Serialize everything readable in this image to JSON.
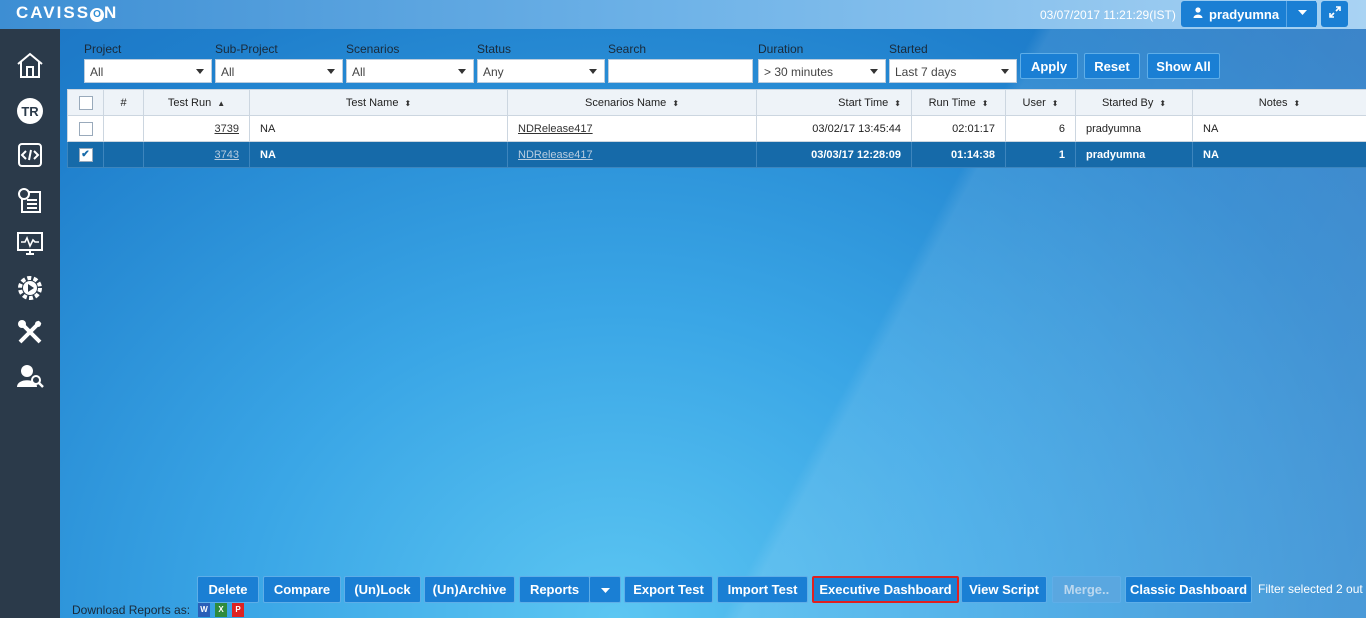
{
  "header": {
    "logo_text": "CAVISS",
    "logo_o": "O",
    "logo_tail": "N",
    "datetime": "03/07/2017 11:21:29(IST)",
    "user_name": "pradyumna",
    "user_icon": "user-icon",
    "expand_icon": "expand-icon"
  },
  "sidebar": {
    "items": [
      {
        "icon": "home-icon"
      },
      {
        "icon": "test-run-icon"
      },
      {
        "icon": "script-code-icon"
      },
      {
        "icon": "reports-icon"
      },
      {
        "icon": "monitor-icon"
      },
      {
        "icon": "settings-play-icon"
      },
      {
        "icon": "tools-icon"
      },
      {
        "icon": "user-search-icon"
      }
    ]
  },
  "filters": {
    "project_label": "Project",
    "project_value": "All",
    "subproject_label": "Sub-Project",
    "subproject_value": "All",
    "scenarios_label": "Scenarios",
    "scenarios_value": "All",
    "status_label": "Status",
    "status_value": "Any",
    "search_label": "Search",
    "search_value": "",
    "duration_label": "Duration",
    "duration_value": "> 30 minutes",
    "started_label": "Started",
    "started_value": "Last 7 days",
    "apply_label": "Apply",
    "reset_label": "Reset",
    "showall_label": "Show All"
  },
  "table": {
    "columns": [
      "#",
      "Test Run",
      "Test Name",
      "Scenarios Name",
      "Start Time",
      "Run Time",
      "User",
      "Started By",
      "Notes"
    ],
    "rows": [
      {
        "num": "",
        "test_run": "3739",
        "test_name": "NA",
        "scenario": "NDRelease417",
        "start_time": "03/02/17 13:45:44",
        "run_time": "02:01:17",
        "user": "6",
        "started_by": "pradyumna",
        "notes": "NA",
        "selected": false
      },
      {
        "num": "",
        "test_run": "3743",
        "test_name": "NA",
        "scenario": "NDRelease417",
        "start_time": "03/03/17 12:28:09",
        "run_time": "01:14:38",
        "user": "1",
        "started_by": "pradyumna",
        "notes": "NA",
        "selected": true
      }
    ]
  },
  "footer": {
    "delete_label": "Delete",
    "compare_label": "Compare",
    "unlock_label": "(Un)Lock",
    "unarchive_label": "(Un)Archive",
    "reports_label": "Reports",
    "export_label": "Export Test",
    "import_label": "Import Test",
    "executive_label": "Executive Dashboard",
    "viewscript_label": "View Script",
    "merge_label": "Merge..",
    "classic_label": "Classic Dashboard",
    "filter_status": "Filter selected 2 out",
    "download_label": "Download Reports as:"
  },
  "colors": {
    "accent": "#1a7fd4",
    "sidebar": "#2b3a4a",
    "selected_row": "#166aa9",
    "highlight": "#e02020"
  }
}
